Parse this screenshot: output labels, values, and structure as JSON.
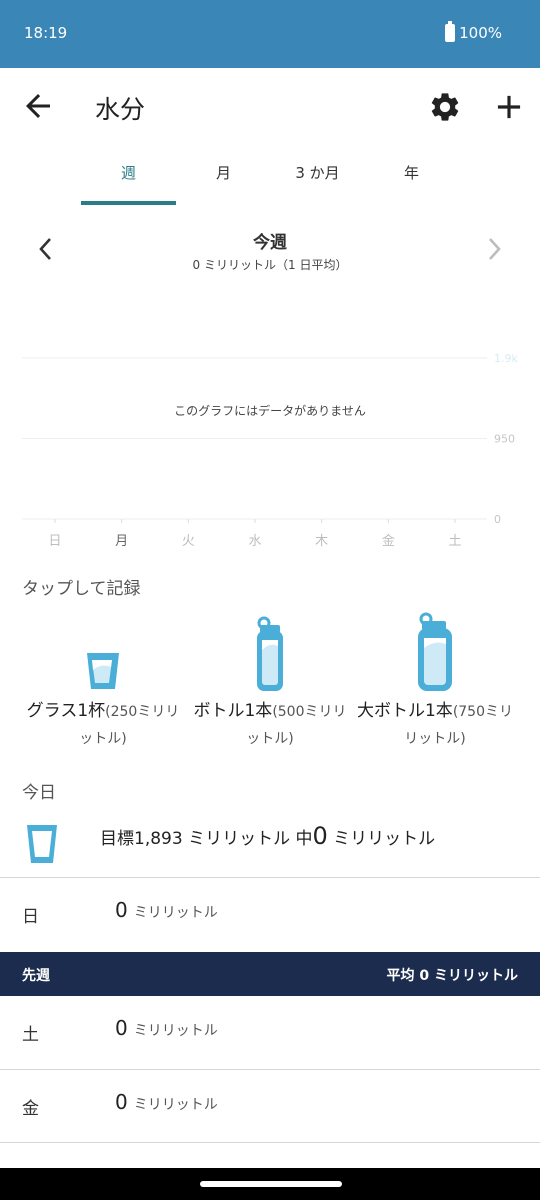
{
  "status": {
    "time": "18:19",
    "battery": "100%"
  },
  "header": {
    "title": "水分"
  },
  "tabs": [
    {
      "label": "週",
      "active": true
    },
    {
      "label": "月",
      "active": false
    },
    {
      "label": "3 か月",
      "active": false
    },
    {
      "label": "年",
      "active": false
    }
  ],
  "period": {
    "title": "今週",
    "subtitle": "0 ミリリットル（1 日平均）"
  },
  "chart_data": {
    "type": "bar",
    "categories": [
      "日",
      "月",
      "火",
      "水",
      "木",
      "金",
      "土"
    ],
    "values": [
      0,
      0,
      0,
      0,
      0,
      0,
      0
    ],
    "y_ticks": [
      "1.9k",
      "950",
      "0"
    ],
    "ylim": [
      0,
      1900
    ],
    "empty_message": "このグラフにはデータがありません",
    "grid": true
  },
  "quick_log": {
    "heading": "タップして記録",
    "options": [
      {
        "name": "グラス1杯",
        "detail1": "(250ミリリ",
        "detail2": "ットル)"
      },
      {
        "name": "ボトル1本",
        "detail1": "(500ミリリ",
        "detail2": "ットル)"
      },
      {
        "name": "大ボトル1本",
        "detail1": "(750ミリ",
        "detail2": "リットル)"
      }
    ]
  },
  "today": {
    "heading": "今日",
    "goal_prefix": "目標1,893 ミリリットル 中",
    "amount": "0",
    "unit": " ミリリットル"
  },
  "days": [
    {
      "day": "日",
      "value": "0",
      "unit": "ミリリットル"
    }
  ],
  "last_week": {
    "label": "先週",
    "average": "平均 0 ミリリットル",
    "days": [
      {
        "day": "土",
        "value": "0",
        "unit": "ミリリットル"
      },
      {
        "day": "金",
        "value": "0",
        "unit": "ミリリットル"
      }
    ]
  },
  "colors": {
    "status_bar": "#3a86b6",
    "accent": "#2a7d86",
    "water": "#4aaed9",
    "week_header": "#1c2c4e"
  }
}
